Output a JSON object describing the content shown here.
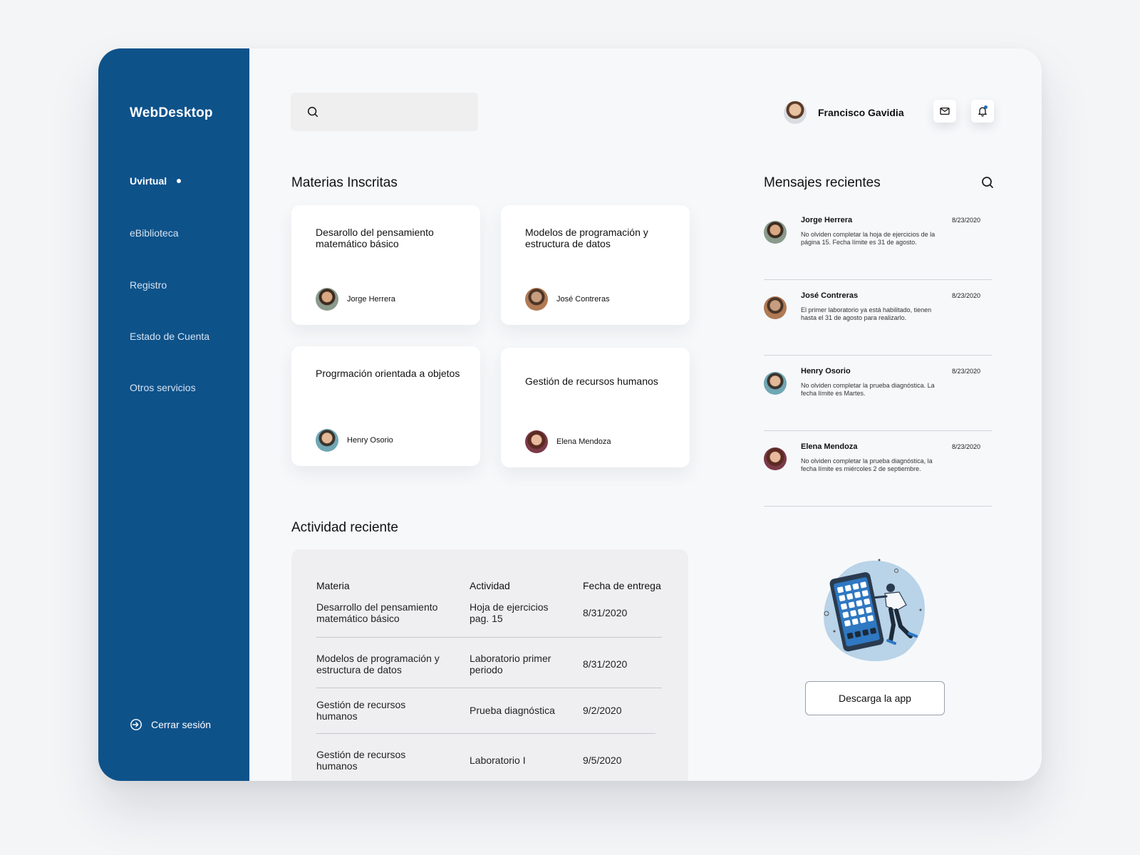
{
  "brand": {
    "logo": "WebDesktop"
  },
  "sidebar": {
    "items": [
      {
        "label": "Uvirtual",
        "active": true
      },
      {
        "label": "eBiblioteca",
        "active": false
      },
      {
        "label": "Registro",
        "active": false
      },
      {
        "label": "Estado de Cuenta",
        "active": false
      },
      {
        "label": "Otros servicios",
        "active": false
      }
    ],
    "logout_label": "Cerrar sesión"
  },
  "search": {
    "placeholder": "",
    "value": ""
  },
  "user": {
    "name": "Francisco Gavidia"
  },
  "courses": {
    "title": "Materias Inscritas",
    "items": [
      {
        "title": "Desarollo del pensamiento matemático básico",
        "teacher": "Jorge Herrera"
      },
      {
        "title": "Modelos de programación y estructura de datos",
        "teacher": "José Contreras"
      },
      {
        "title": "Progrmación orientada a objetos",
        "teacher": "Henry Osorio"
      },
      {
        "title": "Gestión de recursos humanos",
        "teacher": "Elena Mendoza"
      }
    ]
  },
  "activity": {
    "title": "Actividad reciente",
    "columns": [
      "Materia",
      "Actividad",
      "Fecha de entrega"
    ],
    "rows": [
      {
        "materia": "Desarrollo del pensamiento matemático básico",
        "actividad": "Hoja de ejercicios pag. 15",
        "fecha": "8/31/2020"
      },
      {
        "materia": "Modelos de programación y estructura de datos",
        "actividad": "Laboratorio primer periodo",
        "fecha": "8/31/2020"
      },
      {
        "materia": "Gestión de recursos humanos",
        "actividad": "Prueba diagnóstica",
        "fecha": "9/2/2020"
      },
      {
        "materia": "Gestión de recursos humanos",
        "actividad": "Laboratorio I",
        "fecha": "9/5/2020"
      }
    ]
  },
  "messages": {
    "title": "Mensajes recientes",
    "items": [
      {
        "name": "Jorge Herrera",
        "date": "8/23/2020",
        "text": "No olviden completar la hoja de ejercicios de la página 15. Fecha límite es 31 de agosto."
      },
      {
        "name": "José Contreras",
        "date": "8/23/2020",
        "text": "El primer laboratorio ya está habilitado, tienen hasta el 31 de agosto para realizarlo."
      },
      {
        "name": "Henry Osorio",
        "date": "8/23/2020",
        "text": "No olviden completar la prueba diagnóstica.  La fecha límite es Martes."
      },
      {
        "name": "Elena Mendoza",
        "date": "8/23/2020",
        "text": "No olviden completar la prueba diagnóstica, la fecha límite es miércoles 2 de septiembre."
      }
    ]
  },
  "app_promo": {
    "button_label": "Descarga la app"
  },
  "icons": {
    "search": "search-icon",
    "mail": "mail-icon",
    "bell": "bell-icon",
    "logout": "logout-icon",
    "illustration": "phone-illustration"
  },
  "colors": {
    "sidebar": "#0e528a",
    "background": "#f7f8fa",
    "accent": "#1f6fb8"
  }
}
